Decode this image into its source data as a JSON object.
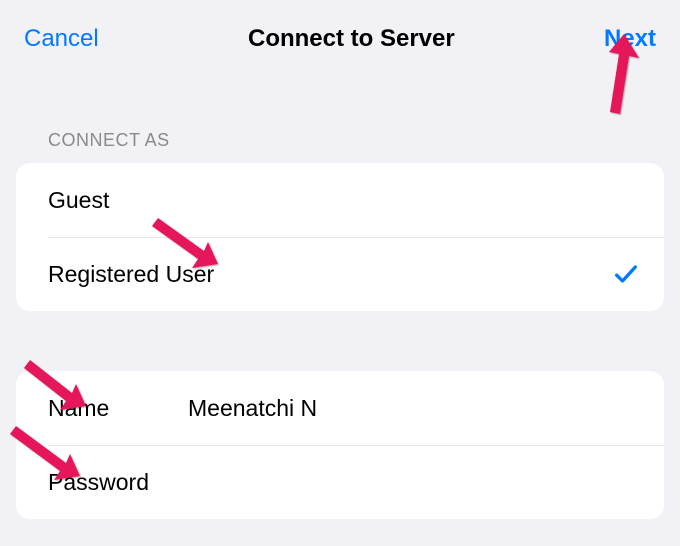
{
  "nav": {
    "cancel": "Cancel",
    "title": "Connect to Server",
    "next": "Next"
  },
  "connect_as": {
    "header": "CONNECT AS",
    "options": [
      {
        "label": "Guest",
        "selected": false
      },
      {
        "label": "Registered User",
        "selected": true
      }
    ]
  },
  "credentials": {
    "name_label": "Name",
    "name_value": "Meenatchi N",
    "password_label": "Password",
    "password_value": ""
  },
  "colors": {
    "accent": "#007aff",
    "background": "#f2f1f6",
    "annotation": "#e6135a"
  }
}
